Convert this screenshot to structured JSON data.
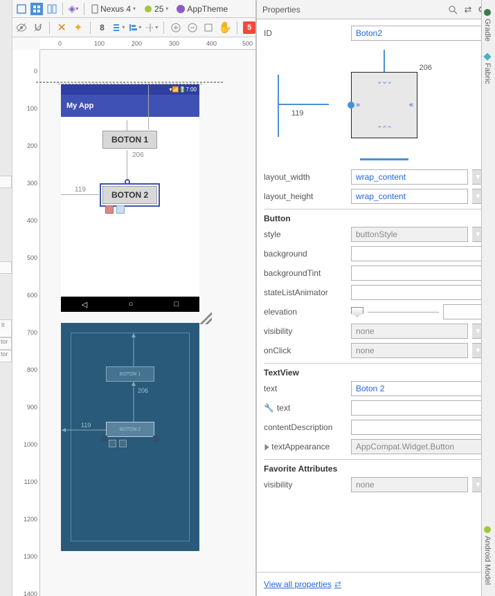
{
  "toolbar": {
    "device": "Nexus 4",
    "api": "25",
    "theme": "AppTheme",
    "zoom_num": "8",
    "error_count": "5"
  },
  "preview": {
    "time": "7:00",
    "app_title": "My App",
    "button1": "BOTON 1",
    "button2": "BOTON 2",
    "measure_v": "206",
    "measure_h": "119"
  },
  "blueprint": {
    "button1": "BOTON 1",
    "button2": "BOTON 2",
    "meas_v": "206",
    "meas_h": "119"
  },
  "ruler_top": [
    "0",
    "100",
    "200",
    "300",
    "400",
    "500"
  ],
  "ruler_left": [
    "0",
    "100",
    "200",
    "300",
    "400",
    "500",
    "600",
    "700",
    "800",
    "900",
    "1000",
    "1100",
    "1200",
    "1300",
    "1400"
  ],
  "properties": {
    "panel_title": "Properties",
    "id_label": "ID",
    "id_value": "Boton2",
    "diagram_top": "206",
    "diagram_left": "119",
    "layout_width_label": "layout_width",
    "layout_width_value": "wrap_content",
    "layout_height_label": "layout_height",
    "layout_height_value": "wrap_content",
    "section_button": "Button",
    "style_label": "style",
    "style_value": "buttonStyle",
    "background_label": "background",
    "backgroundTint_label": "backgroundTint",
    "stateListAnimator_label": "stateListAnimator",
    "elevation_label": "elevation",
    "visibility_label": "visibility",
    "visibility_value": "none",
    "onClick_label": "onClick",
    "onClick_value": "none",
    "section_textview": "TextView",
    "text_label": "text",
    "text_value": "Boton 2",
    "text2_label": "text",
    "contentDescription_label": "contentDescription",
    "textAppearance_label": "textAppearance",
    "textAppearance_value": "AppCompat.Widget.Button",
    "section_fav": "Favorite Attributes",
    "fav_visibility_label": "visibility",
    "fav_visibility_value": "none",
    "view_all": "View all properties"
  },
  "right_tabs": {
    "gradle": "Gradle",
    "fabric": "Fabric",
    "model": "Android Model"
  },
  "left_frag": {
    "txt1": "lt",
    "txt2": "tor",
    "txt3": "tor"
  }
}
